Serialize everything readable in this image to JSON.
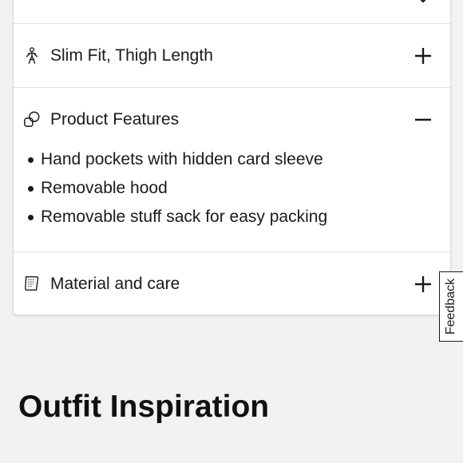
{
  "accordion": {
    "items": [
      {
        "label": "",
        "icon": "partial-row-icon",
        "expanded": false
      },
      {
        "label": "Slim Fit, Thigh Length",
        "icon": "person-fit-icon",
        "expanded": false
      },
      {
        "label": "Product Features",
        "icon": "shapes-icon",
        "expanded": true,
        "details": [
          "Hand pockets with hidden card sleeve",
          "Removable hood",
          "Removable stuff sack for easy packing"
        ]
      },
      {
        "label": "Material and care",
        "icon": "fabric-tag-icon",
        "expanded": false
      }
    ]
  },
  "feedback": {
    "label": "Feedback"
  },
  "section": {
    "title": "Outfit Inspiration"
  },
  "colors": {
    "background": "#f2f2f2",
    "card": "#ffffff",
    "text": "#1a1a1a",
    "divider": "#e2e2e2"
  }
}
